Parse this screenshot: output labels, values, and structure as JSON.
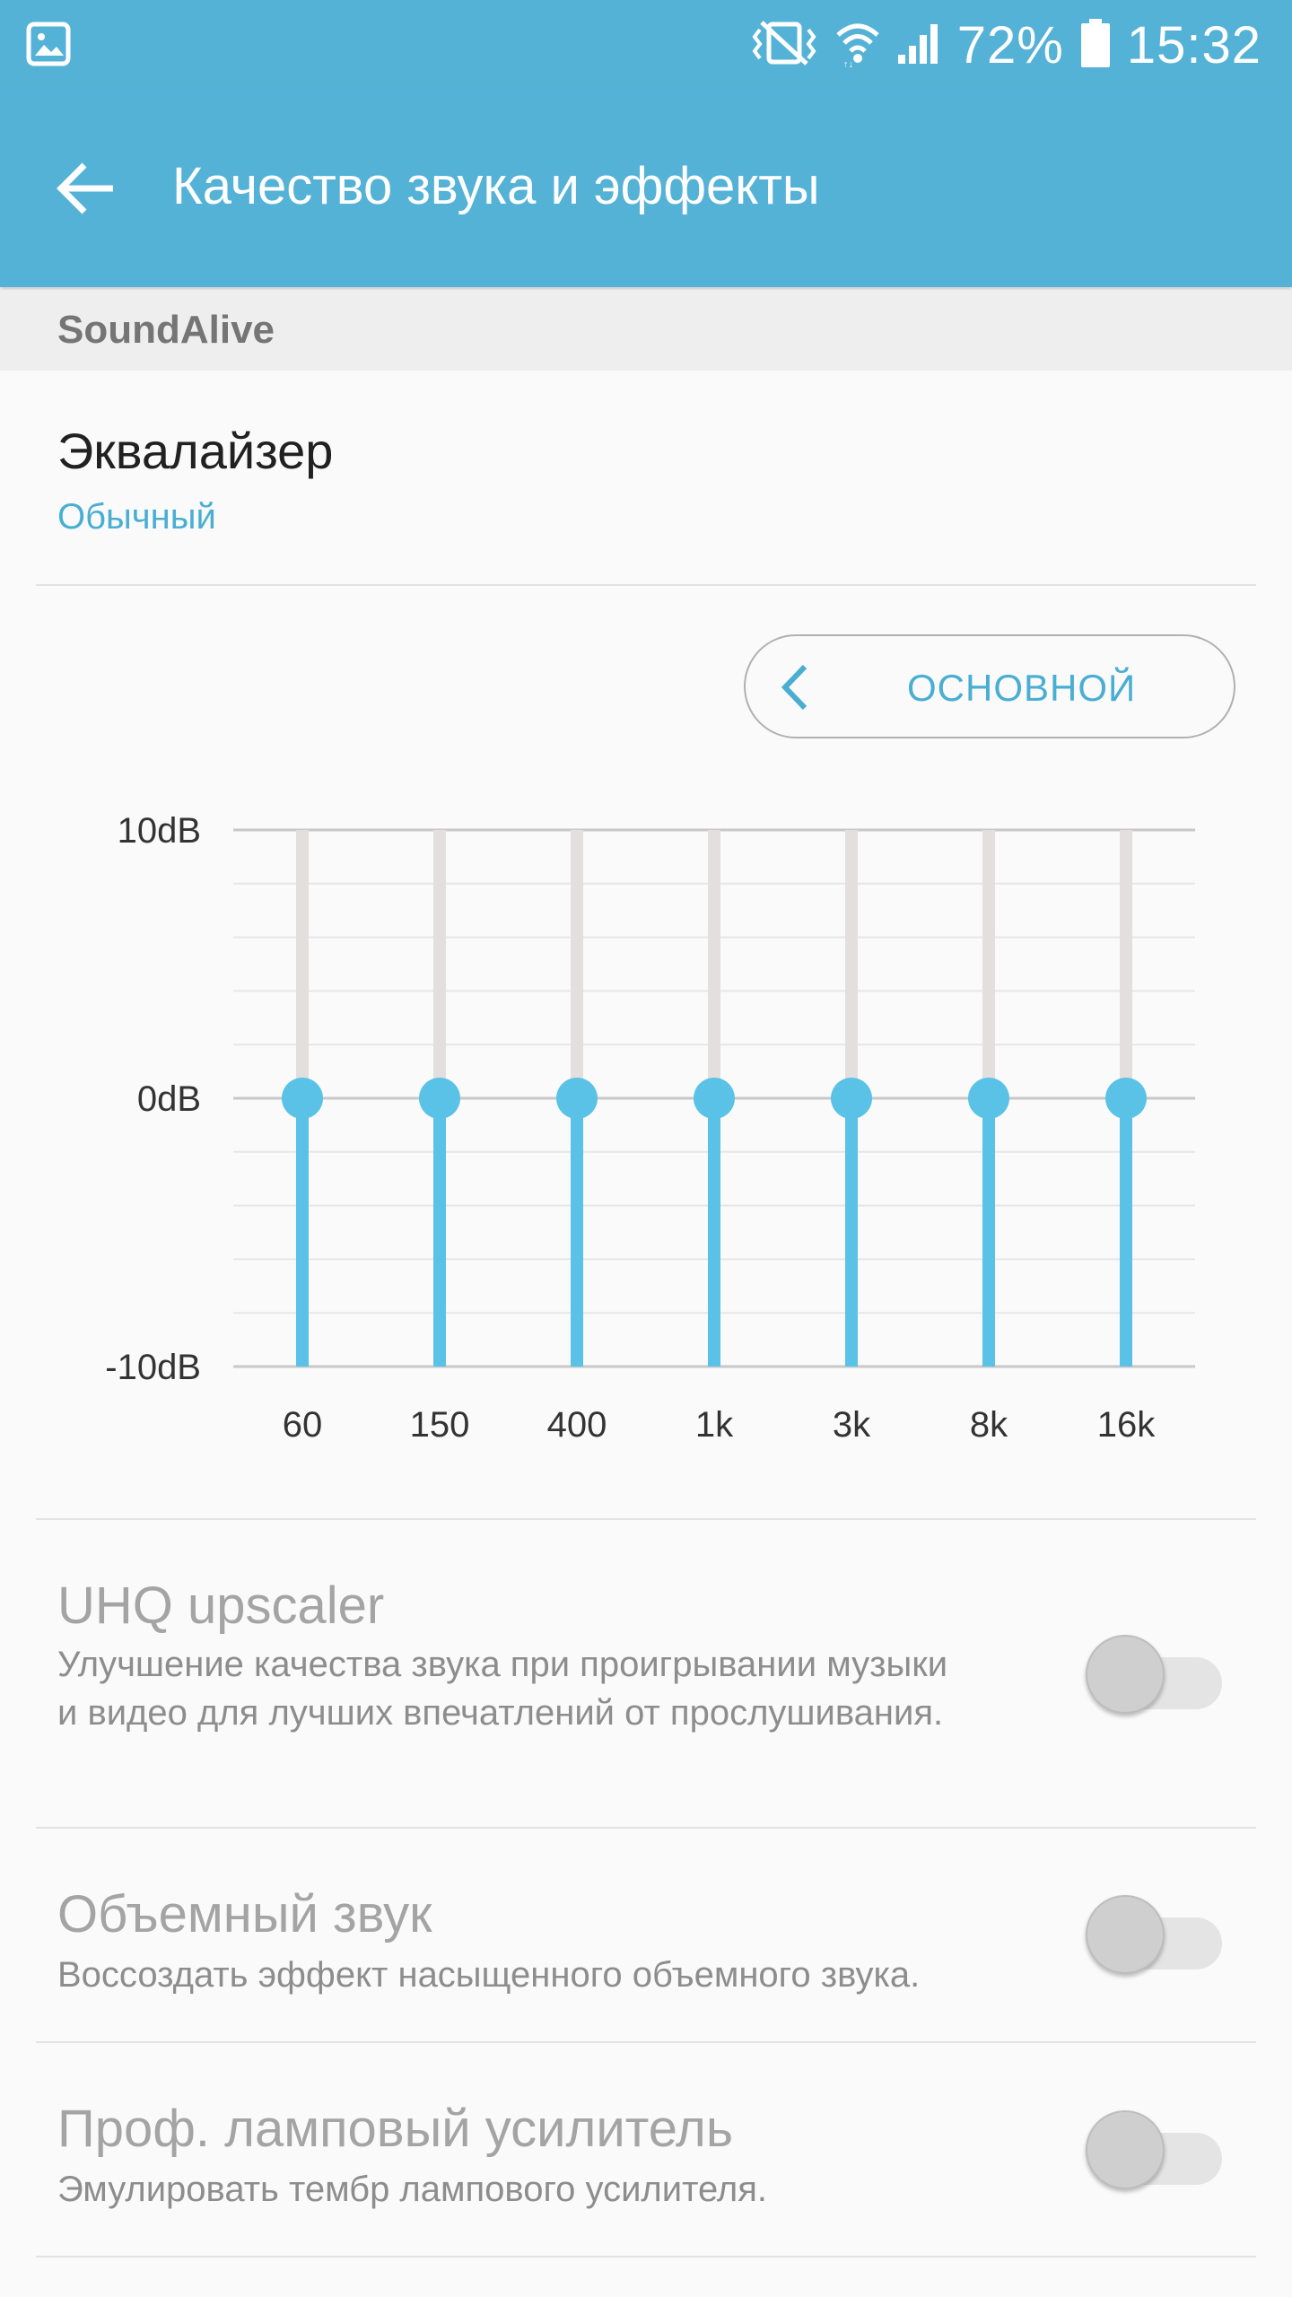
{
  "status_bar": {
    "battery_text": "72%",
    "time": "15:32",
    "icons": [
      "gallery-notification-icon",
      "vibrate-icon",
      "wifi-icon",
      "signal-icon",
      "battery-icon"
    ]
  },
  "app_bar": {
    "title": "Качество звука и эффекты",
    "back_icon": "arrow-left-icon"
  },
  "section": {
    "header": "SoundAlive"
  },
  "equalizer": {
    "title": "Эквалайзер",
    "preset_value": "Обычный",
    "preset_button_label": "ОСНОВНОЙ",
    "db_labels": [
      "10dB",
      "0dB",
      "-10dB"
    ],
    "bands": [
      {
        "label": "60",
        "value_db": 0
      },
      {
        "label": "150",
        "value_db": 0
      },
      {
        "label": "400",
        "value_db": 0
      },
      {
        "label": "1k",
        "value_db": 0
      },
      {
        "label": "3k",
        "value_db": 0
      },
      {
        "label": "8k",
        "value_db": 0
      },
      {
        "label": "16k",
        "value_db": 0
      }
    ],
    "range_db": [
      -10,
      10
    ]
  },
  "settings": [
    {
      "title": "UHQ upscaler",
      "description": "Улучшение качества звука при проигрывании музыки и видео для лучших впечатлений от прослушивания.",
      "enabled": false
    },
    {
      "title": "Объемный звук",
      "description": "Воссоздать эффект насыщенного объемного звука.",
      "enabled": false
    },
    {
      "title": "Проф. ламповый усилитель",
      "description": "Эмулировать тембр лампового усилителя.",
      "enabled": false
    }
  ],
  "colors": {
    "accent": "#55b2d7",
    "slider_active": "#5ac2e6",
    "text_accent": "#4aaed3"
  }
}
